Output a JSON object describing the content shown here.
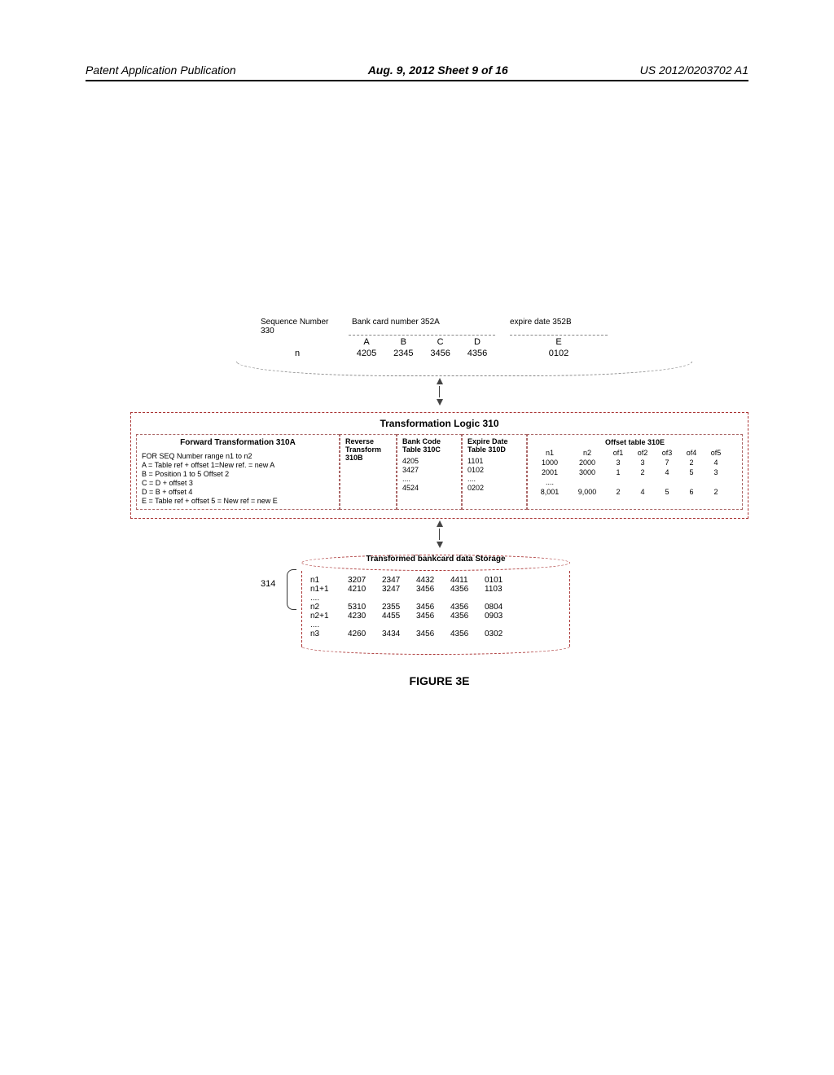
{
  "header": {
    "left": "Patent Application Publication",
    "center": "Aug. 9, 2012  Sheet 9 of 16",
    "right": "US 2012/0203702 A1"
  },
  "input": {
    "seq_label": "Sequence Number 330",
    "bank_label": "Bank card number   352A",
    "expire_label": "expire date  352B",
    "col_heads": [
      "A",
      "B",
      "C",
      "D",
      "E"
    ],
    "seq_value": "n",
    "bank_groups": [
      "4205",
      "2345",
      "3456",
      "4356"
    ],
    "expire_value": "0102"
  },
  "xform": {
    "title": "Transformation Logic   310",
    "forward": {
      "title": "Forward Transformation  310A",
      "lines": [
        "FOR SEQ Number  range n1 to n2",
        "A = Table ref + offset 1=New ref. = new A",
        "B = Position 1 to 5 Offset 2",
        "C = D + offset 3",
        "D = B + offset 4",
        "E = Table ref + offset 5 = New ref = new E"
      ]
    },
    "reverse": {
      "title": "Reverse Transform 310B"
    },
    "bank_code": {
      "title": "Bank Code Table 310C",
      "rows": [
        "4205",
        "3427",
        "....",
        "4524"
      ]
    },
    "expire_date": {
      "title": "Expire Date Table 310D",
      "rows": [
        "1101",
        "0102",
        "....",
        "0202"
      ]
    },
    "offset": {
      "title": "Offset table  310E",
      "cols": [
        "n1",
        "n2",
        "of1",
        "of2",
        "of3",
        "of4",
        "of5"
      ],
      "rows": [
        [
          "1000",
          "2000",
          "3",
          "3",
          "7",
          "2",
          "4"
        ],
        [
          "2001",
          "3000",
          "1",
          "2",
          "4",
          "5",
          "3"
        ],
        [
          "....",
          "",
          "",
          "",
          "",
          "",
          ""
        ],
        [
          "8,001",
          "9,000",
          "2",
          "4",
          "5",
          "6",
          "2"
        ]
      ]
    }
  },
  "storage": {
    "ref": "314",
    "title": "Transformed bankcard data Storage",
    "rows": [
      [
        "n1",
        "3207",
        "2347",
        "4432",
        "4411",
        "0101"
      ],
      [
        "n1+1",
        "4210",
        "3247",
        "3456",
        "4356",
        "1103"
      ],
      [
        "....",
        "",
        "",
        "",
        "",
        ""
      ],
      [
        "n2",
        "5310",
        "2355",
        "3456",
        "4356",
        "0804"
      ],
      [
        "n2+1",
        "4230",
        "4455",
        "3456",
        "4356",
        "0903"
      ],
      [
        "....",
        "",
        "",
        "",
        "",
        ""
      ],
      [
        "n3",
        "4260",
        "3434",
        "3456",
        "4356",
        "0302"
      ]
    ]
  },
  "caption": "FIGURE 3E"
}
